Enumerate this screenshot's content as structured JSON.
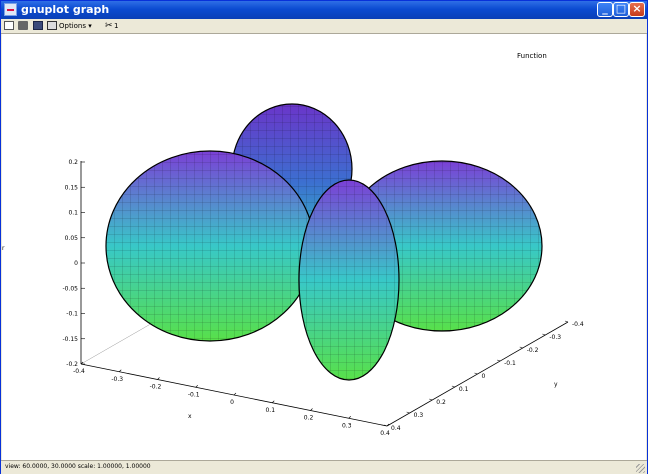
{
  "window": {
    "title": "gnuplot graph"
  },
  "toolbar": {
    "options_label": "Options",
    "options_arrow": "▾",
    "mouse_value": "1",
    "icons": [
      "copy-icon",
      "print-icon",
      "save-icon",
      "options-icon",
      "mouse-icon"
    ]
  },
  "plot": {
    "key_label": "Function",
    "z_ticks": [
      "0.2",
      "0.15",
      "0.1",
      "0.05",
      "0",
      "-0.05",
      "-0.1",
      "-0.15",
      "-0.2"
    ],
    "x_ticks": [
      "-0.4",
      "-0.3",
      "-0.2",
      "-0.1",
      "0",
      "0.1",
      "0.2",
      "0.3",
      "0.4"
    ],
    "y_ticks": [
      "-0.4",
      "-0.3",
      "-0.2",
      "-0.1",
      "0",
      "0.1",
      "0.2",
      "0.3",
      "0.4"
    ],
    "x_label": "x",
    "y_label": "y",
    "z_label": "r",
    "colors": {
      "top": "#7b3fd6",
      "mid": "#38c8c8",
      "bottom": "#58e04a"
    }
  },
  "status": {
    "text": "view: 60.0000, 30.0000   scale: 1.00000, 1.00000"
  }
}
